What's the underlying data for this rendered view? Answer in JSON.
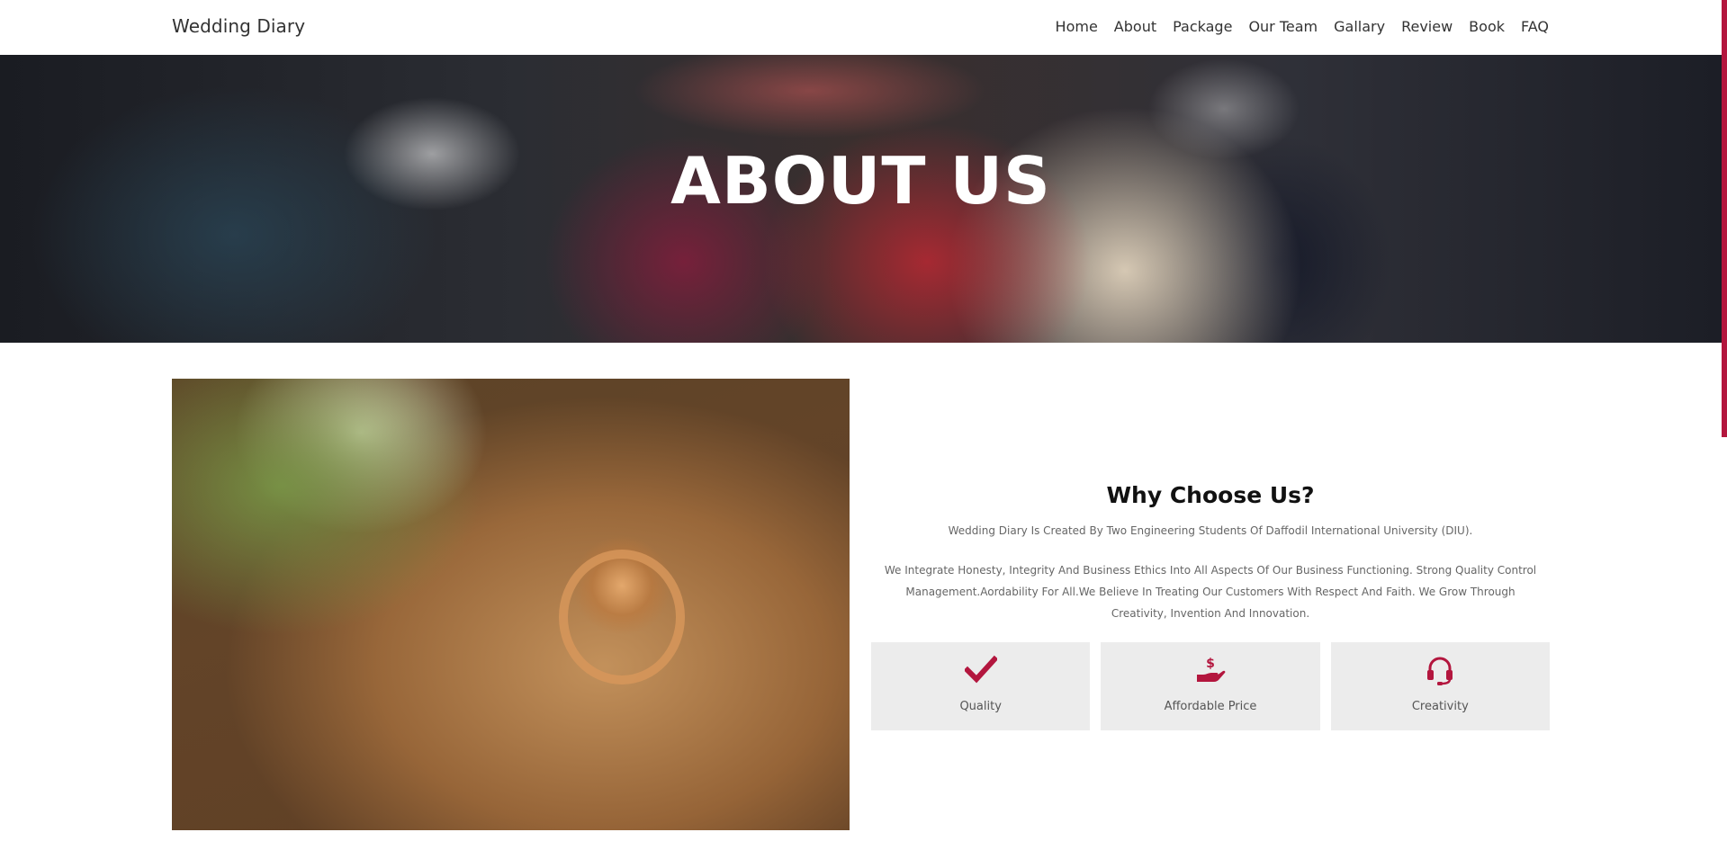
{
  "header": {
    "brand": "Wedding Diary",
    "nav": [
      "Home",
      "About",
      "Package",
      "Our Team",
      "Gallary",
      "Review",
      "Book",
      "FAQ"
    ]
  },
  "hero": {
    "title": "ABOUT US"
  },
  "about": {
    "heading": "Why Choose Us?",
    "paragraph1": "Wedding Diary Is Created By Two Engineering Students Of Daffodil International University (DIU).",
    "paragraph2": "We Integrate Honesty, Integrity And Business Ethics Into All Aspects Of Our Business Functioning. Strong Quality Control Management.Aordability For All.We Believe In Treating Our Customers With Respect And Faith. We Grow Through Creativity, Invention And Innovation."
  },
  "features": [
    {
      "label": "Quality",
      "icon": "check-icon"
    },
    {
      "label": "Affordable Price",
      "icon": "hand-dollar-icon"
    },
    {
      "label": "Creativity",
      "icon": "headset-icon"
    }
  ],
  "colors": {
    "accent": "#b3163e",
    "feature_bg": "#ececec"
  }
}
